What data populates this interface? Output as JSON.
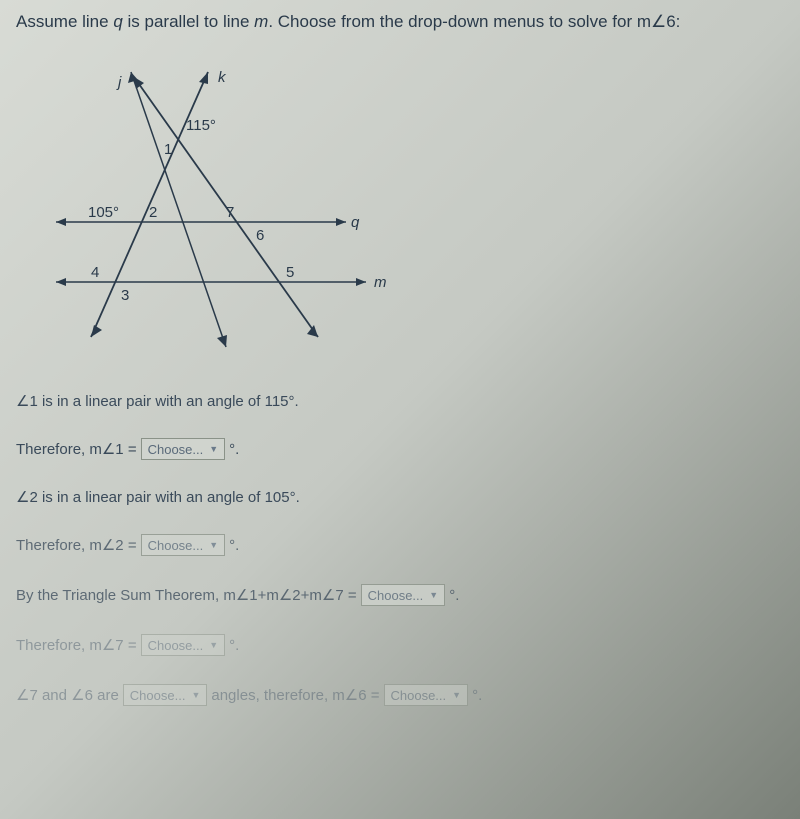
{
  "question": {
    "prefix": "Assume line ",
    "q": "q",
    "mid": " is parallel to line ",
    "m": "m",
    "suffix": ". Choose from the drop-down menus to solve for m∠6:"
  },
  "diagram": {
    "labels": {
      "j": "j",
      "k": "k",
      "q": "q",
      "m": "m",
      "angle115": "115°",
      "angle105": "105°",
      "n1": "1",
      "n2": "2",
      "n3": "3",
      "n4": "4",
      "n5": "5",
      "n6": "6",
      "n7": "7"
    }
  },
  "proof": {
    "line1": "∠1 is in a linear pair with an angle of 115°.",
    "line2_prefix": "Therefore, m∠1 = ",
    "line2_suffix": "°.",
    "line3": "∠2 is in a linear pair with an angle of 105°.",
    "line4_prefix": "Therefore, m∠2 = ",
    "line4_suffix": "°.",
    "line5_prefix": "By the Triangle Sum Theorem, m∠1+m∠2+m∠7 = ",
    "line5_suffix": "°.",
    "line6_prefix": "Therefore, m∠7 = ",
    "line6_suffix": "°.",
    "line7_prefix": "∠7 and ∠6 are ",
    "line7_mid": " angles, therefore, m∠6 = ",
    "line7_suffix": "°."
  },
  "dropdown": {
    "placeholder": "Choose..."
  }
}
